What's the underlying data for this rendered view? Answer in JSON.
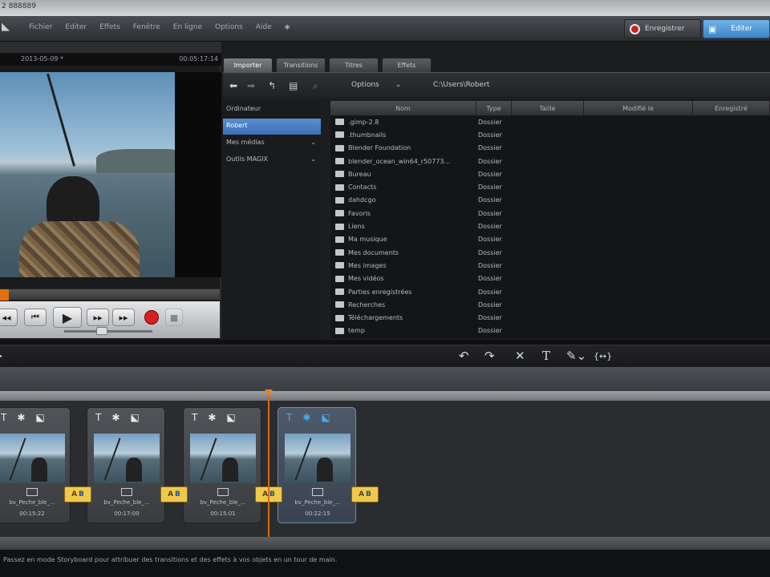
{
  "window": {
    "title": "2 888889"
  },
  "menu": {
    "items": [
      "Fichier",
      "Editer",
      "Effets",
      "Fenêtre",
      "En ligne",
      "Options",
      "Aide"
    ],
    "share_icon": "share-icon"
  },
  "mode_buttons": {
    "record_label": "Enregistrer",
    "edit_label": "Editer"
  },
  "preview": {
    "date": "2013-05-09 *",
    "timecode": "00:05:17:14",
    "progress": 0.04
  },
  "media": {
    "tabs": [
      "Importer",
      "Transitions",
      "Titres",
      "Effets"
    ],
    "active_tab": 0,
    "options_label": "Options",
    "path": "C:\\Users\\Robert",
    "tree": [
      {
        "label": "Ordinateur",
        "selected": false,
        "expand": ""
      },
      {
        "label": "Robert",
        "selected": true,
        "expand": ""
      },
      {
        "label": "Mes médias",
        "selected": false,
        "expand": "⌄"
      },
      {
        "label": "Outils MAGIX",
        "selected": false,
        "expand": "⌄"
      }
    ],
    "columns": [
      "Nom",
      "Type",
      "Taille",
      "Modifié le",
      "Enregistré"
    ],
    "files": [
      {
        "name": ".gimp-2.8",
        "type": "Dossier"
      },
      {
        "name": ".thumbnails",
        "type": "Dossier"
      },
      {
        "name": "Blender Foundation",
        "type": "Dossier"
      },
      {
        "name": "blender_ocean_win64_r50773...",
        "type": "Dossier"
      },
      {
        "name": "Bureau",
        "type": "Dossier"
      },
      {
        "name": "Contacts",
        "type": "Dossier"
      },
      {
        "name": "dahdcgo",
        "type": "Dossier"
      },
      {
        "name": "Favoris",
        "type": "Dossier"
      },
      {
        "name": "Liens",
        "type": "Dossier"
      },
      {
        "name": "Ma musique",
        "type": "Dossier"
      },
      {
        "name": "Mes documents",
        "type": "Dossier"
      },
      {
        "name": "Mes images",
        "type": "Dossier"
      },
      {
        "name": "Mes vidéos",
        "type": "Dossier"
      },
      {
        "name": "Parties enregistrées",
        "type": "Dossier"
      },
      {
        "name": "Recherches",
        "type": "Dossier"
      },
      {
        "name": "Téléchargements",
        "type": "Dossier"
      },
      {
        "name": "temp",
        "type": "Dossier"
      }
    ]
  },
  "timeline": {
    "clips": [
      {
        "name": "bv_Peche_ble_...",
        "duration": "00:15:22",
        "selected": false
      },
      {
        "name": "bv_Peche_ble_...",
        "duration": "00:17:00",
        "selected": false
      },
      {
        "name": "bv_Peche_ble_...",
        "duration": "00:15:01",
        "selected": false
      },
      {
        "name": "bv_Peche_ble_...",
        "duration": "00:22:15",
        "selected": true
      }
    ],
    "transition_label_a": "A",
    "transition_label_b": "B"
  },
  "status": {
    "text": "Passez en mode Storyboard pour attribuer des transitions et des effets à vos objets en un tour de main."
  },
  "colors": {
    "accent": "#3d86c8",
    "playhead": "#d56a10",
    "record": "#d12020"
  }
}
